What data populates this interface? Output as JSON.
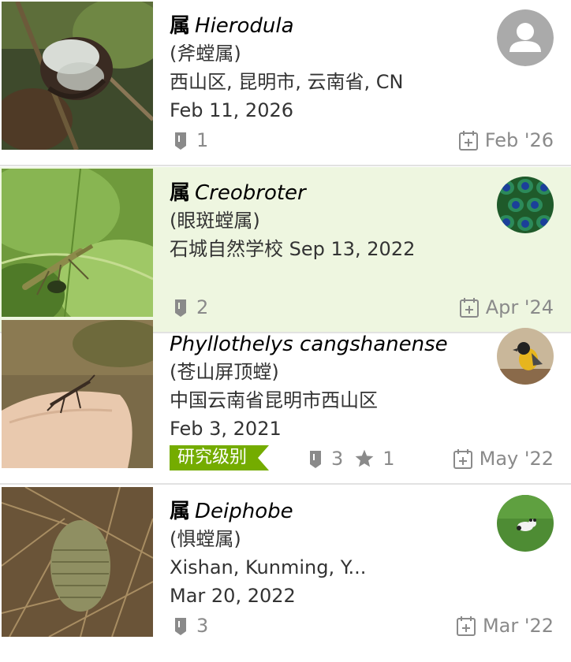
{
  "observations": [
    {
      "rank": "属",
      "scientific_name": "Hierodula",
      "common_name": "(斧螳属)",
      "place": "西山区, 昆明市, 云南省, CN",
      "observed_date": "Feb 11, 2026",
      "identifications": "1",
      "faves": "",
      "quality_badge": "",
      "uploaded": "Feb '26"
    },
    {
      "rank": "属",
      "scientific_name": "Creobroter",
      "common_name": "(眼斑螳属)",
      "place": "石城自然学校 Sep 13, 2022",
      "observed_date": "",
      "identifications": "2",
      "faves": "",
      "quality_badge": "",
      "uploaded": "Apr '24"
    },
    {
      "rank": "",
      "scientific_name": "Phyllothelys cangshanense",
      "common_name": "(苍山屏顶螳)",
      "place": "中国云南省昆明市西山区",
      "observed_date": "Feb 3, 2021",
      "identifications": "3",
      "faves": "1",
      "quality_badge": "研究级别",
      "uploaded": "May '22"
    },
    {
      "rank": "属",
      "scientific_name": "Deiphobe",
      "common_name": "(惧螳属)",
      "place": "Xishan, Kunming, Y...",
      "observed_date": "Mar 20, 2022",
      "identifications": "3",
      "faves": "",
      "quality_badge": "",
      "uploaded": "Mar '22"
    }
  ],
  "icons": {
    "identification": "id-tag-icon",
    "fave": "star-icon",
    "upload": "calendar-plus-icon",
    "default_avatar": "user-icon"
  },
  "colors": {
    "highlight_row": "#eef6e0",
    "research_grade": "#74ac00",
    "meta_text": "#8a8a8a",
    "divider": "#e2e2e2"
  }
}
